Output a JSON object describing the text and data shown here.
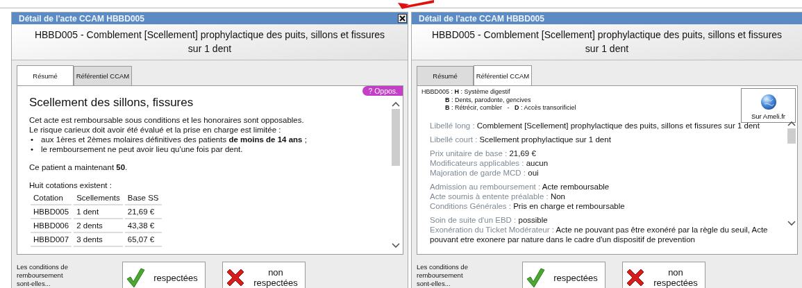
{
  "windows": [
    {
      "title": "Détail de l'acte CCAM HBBD005",
      "close_button": true,
      "heading": "HBBD005 - Comblement [Scellement] prophylactique des puits, sillons et fissures sur 1 dent",
      "tabs": [
        {
          "label": "Résumé",
          "selected": true
        },
        {
          "label": "Référentiel CCAM",
          "selected": false
        }
      ],
      "panel": {
        "kind": "summary",
        "badge": "? Oppos.",
        "title": "Scellement des sillons, fissures",
        "intro": [
          "Cet acte est remboursable sous conditions et les honoraires sont opposables.",
          "Le risque carieux doit avoir été évalué et la prise en charge est limitée :"
        ],
        "bullets": [
          {
            "marker": "•",
            "text": "aux 1ères et 2èmes molaires définitives des patients **de moins de 14 ans** ;"
          },
          {
            "marker": "•",
            "text": "le remboursement ne peut avoir lieu qu'une fois par dent."
          }
        ],
        "patient_note": "Ce patient a maintenant **50**.",
        "cotations_intro": "Huit cotations existent :",
        "table": {
          "columns": [
            "Cotation",
            "Scellements",
            "Base SS"
          ],
          "rows": [
            [
              "HBBD005",
              "1 dent",
              "21,69 €"
            ],
            [
              "HBBD006",
              "2 dents",
              "43,38 €"
            ],
            [
              "HBBD007",
              "3 dents",
              "65,07 €"
            ]
          ]
        }
      },
      "footer": {
        "question": "Les conditions de remboursement sont-elles...",
        "buttons": [
          {
            "kind": "accept",
            "label": "respectées"
          },
          {
            "kind": "reject",
            "label": "non respectées"
          }
        ]
      }
    },
    {
      "title": "Détail de l'acte CCAM HBBD005",
      "close_button": false,
      "heading": "HBBD005 - Comblement [Scellement] prophylactique des puits, sillons et fissures sur 1 dent",
      "tabs": [
        {
          "label": "Résumé",
          "selected": false
        },
        {
          "label": "Référentiel CCAM",
          "selected": true
        }
      ],
      "panel": {
        "kind": "referential",
        "hierarchy": [
          "HBBD005 : **H** : Système digestif",
          "**B** : Dents, parodonte, gencives",
          "**B** : Rétrécir, combler   -   **D** : Accès transorificiel"
        ],
        "ameli_button": "Sur Ameli.fr",
        "groups": [
          [
            {
              "label": "Libellé long :",
              "value": "Comblement [Scellement] prophylactique des puits, sillons et fissures sur 1 dent"
            }
          ],
          [
            {
              "label": "Libellé court :",
              "value": "Scellement prophylactique  sur 1 dent"
            }
          ],
          [
            {
              "label": "Prix unitaire de base :",
              "value": "21,69 €"
            },
            {
              "label": "Modificateurs applicables :",
              "value": "aucun"
            },
            {
              "label": "Majoration de garde MCD :",
              "value": "oui"
            }
          ],
          [
            {
              "label": "Admission au remboursement :",
              "value": "Acte remboursable"
            },
            {
              "label": "Acte soumis à entente préalable :",
              "value": "Non"
            },
            {
              "label": "Conditions Générales :",
              "value": "Pris en charge et remboursable"
            }
          ],
          [
            {
              "label": "Soin de suite d'un EBD :",
              "value": "possible"
            },
            {
              "label": "Exonération du Ticket Modérateur :",
              "value": "Acte ne pouvant pas être exonéré par la règle du seuil, Acte pouvant etre exonere par nature dans le cadre d'un dispositif de prevention"
            }
          ]
        ]
      },
      "footer": {
        "question": "Les conditions de remboursement sont-elles...",
        "buttons": [
          {
            "kind": "accept",
            "label": "respectées"
          },
          {
            "kind": "reject",
            "label": "non respectées"
          }
        ]
      }
    }
  ]
}
